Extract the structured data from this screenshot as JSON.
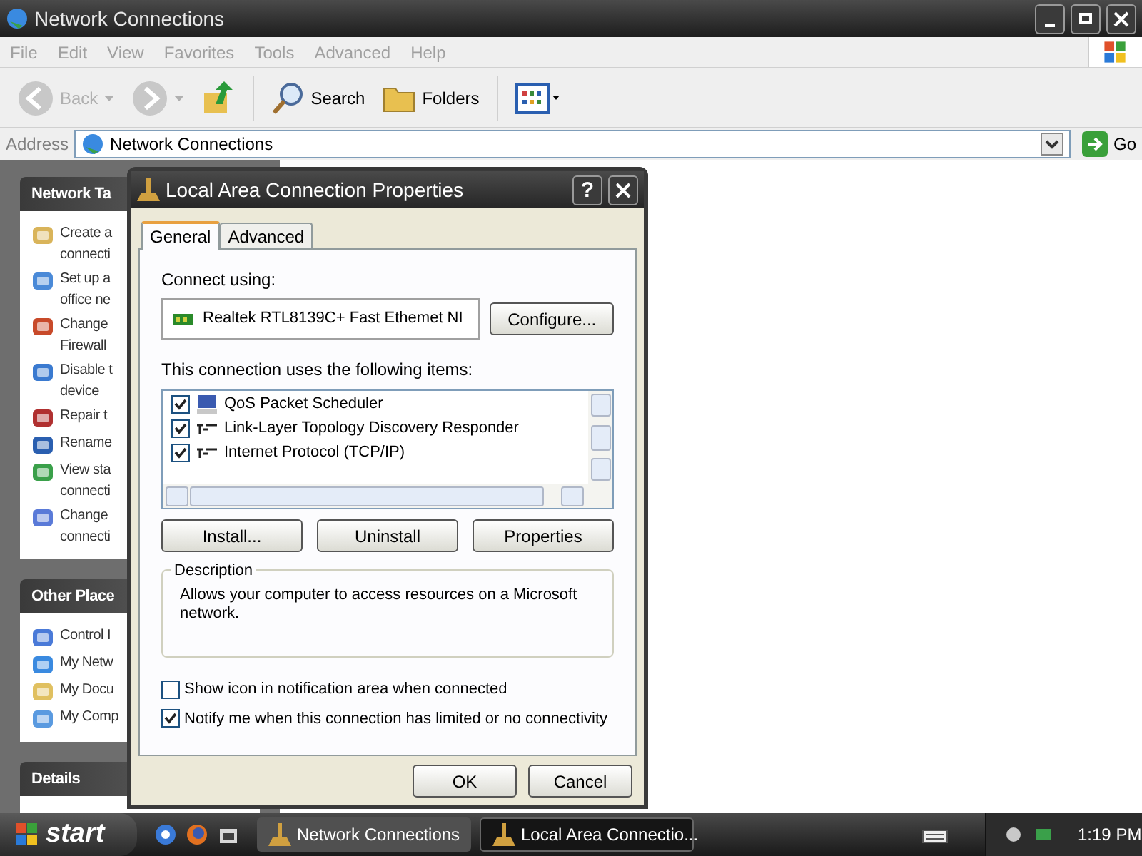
{
  "window": {
    "title": "Network Connections"
  },
  "menu": [
    "File",
    "Edit",
    "View",
    "Favorites",
    "Tools",
    "Advanced",
    "Help"
  ],
  "toolbar": [
    {
      "kind": "back",
      "label": "Back",
      "disabled": true
    },
    {
      "kind": "forward",
      "disabled": true
    },
    {
      "kind": "up",
      "disabled": false
    },
    {
      "kind": "search",
      "label": "Search",
      "disabled": false
    },
    {
      "kind": "folders",
      "label": "Folders",
      "disabled": false
    },
    {
      "kind": "views",
      "disabled": false
    }
  ],
  "address": {
    "label": "Address",
    "value": "Network Connections",
    "go": "Go"
  },
  "sidebar": [
    {
      "title": "Network Ta",
      "items": [
        {
          "lines": [
            "Create a",
            "connecti"
          ]
        },
        {
          "lines": [
            "Set up a",
            "office ne"
          ]
        },
        {
          "lines": [
            "Change",
            "Firewall"
          ]
        },
        {
          "lines": [
            "Disable t",
            "device"
          ]
        },
        {
          "lines": [
            "Repair t"
          ]
        },
        {
          "lines": [
            "Rename"
          ]
        },
        {
          "lines": [
            "View sta",
            "connecti"
          ]
        },
        {
          "lines": [
            "Change",
            "connecti"
          ]
        }
      ]
    },
    {
      "title": "Other Place",
      "items": [
        {
          "lines": [
            "Control I"
          ]
        },
        {
          "lines": [
            "My Netw"
          ]
        },
        {
          "lines": [
            "My Docu"
          ]
        },
        {
          "lines": [
            "My Comp"
          ]
        }
      ]
    },
    {
      "title": "Details"
    }
  ],
  "dialog": {
    "title": "Local Area Connection Properties",
    "help": "?",
    "tabs": [
      {
        "label": "General",
        "selected": true
      },
      {
        "label": "Advanced",
        "selected": false
      }
    ],
    "connect_using": "Connect using:",
    "adapter": "Realtek RTL8139C+ Fast Ethemet NI",
    "configure": "Configure...",
    "items_label": "This connection uses the following items:",
    "components": [
      {
        "kind": "scheduler",
        "label": "QoS Packet Scheduler",
        "checked": true
      },
      {
        "kind": "protocol",
        "label": "Link-Layer Topology Discovery Responder",
        "checked": true
      },
      {
        "kind": "protocol",
        "label": "Internet Protocol (TCP/IP)",
        "checked": true
      }
    ],
    "actions": [
      "Install...",
      "Uninstall",
      "Properties"
    ],
    "description": {
      "legend": "Description",
      "text": "Allows your computer to access resources on a Microsoft network."
    },
    "options": [
      {
        "label": "Show icon in notification area when connected",
        "checked": false
      },
      {
        "label": "Notify me when this connection has limited or no connectivity",
        "checked": true
      }
    ],
    "buttons": [
      "OK",
      "Cancel"
    ]
  },
  "taskbar": {
    "start": "start",
    "tasks": [
      {
        "label": "Network Connections",
        "selected": false
      },
      {
        "label": "Local Area Connectio...",
        "selected": true
      }
    ],
    "clock": "1:19 PM"
  }
}
